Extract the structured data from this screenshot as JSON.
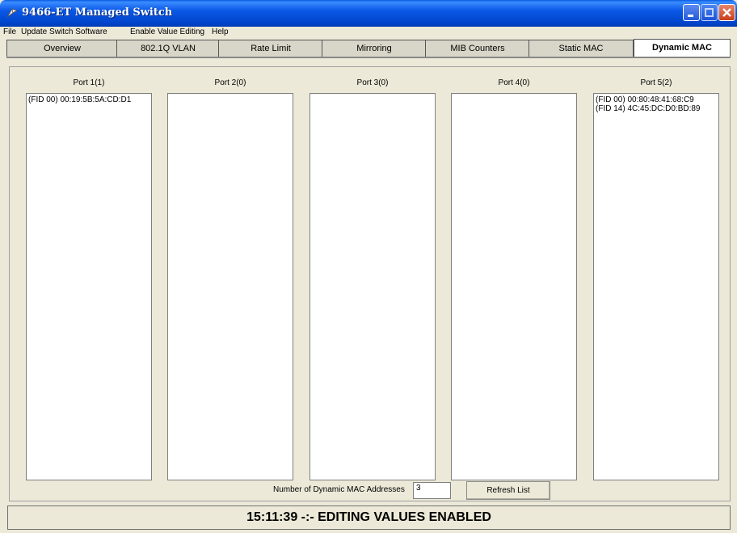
{
  "window": {
    "title": "9466-ET Managed Switch"
  },
  "menu": [
    "File",
    "Update Switch Software",
    "Enable Value Editing",
    "Help"
  ],
  "tabs": [
    "Overview",
    "802.1Q VLAN",
    "Rate Limit",
    "Mirroring",
    "MIB Counters",
    "Static MAC",
    "Dynamic MAC"
  ],
  "active_tab": "Dynamic MAC",
  "ports": [
    {
      "label": "Port 1(1)",
      "entries": [
        "(FID 00) 00:19:5B:5A:CD:D1"
      ]
    },
    {
      "label": "Port 2(0)",
      "entries": []
    },
    {
      "label": "Port 3(0)",
      "entries": []
    },
    {
      "label": "Port 4(0)",
      "entries": []
    },
    {
      "label": "Port 5(2)",
      "entries": [
        "(FID 00) 00:80:48:41:68:C9",
        "(FID 14) 4C:45:DC:D0:BD:89"
      ]
    }
  ],
  "footer": {
    "count_label": "Number of Dynamic MAC Addresses",
    "count_value": "3",
    "refresh_label": "Refresh List"
  },
  "status": "15:11:39 -:- EDITING VALUES ENABLED",
  "colors": {
    "titlebar": "#0a58e6",
    "background": "#ece9d8"
  }
}
